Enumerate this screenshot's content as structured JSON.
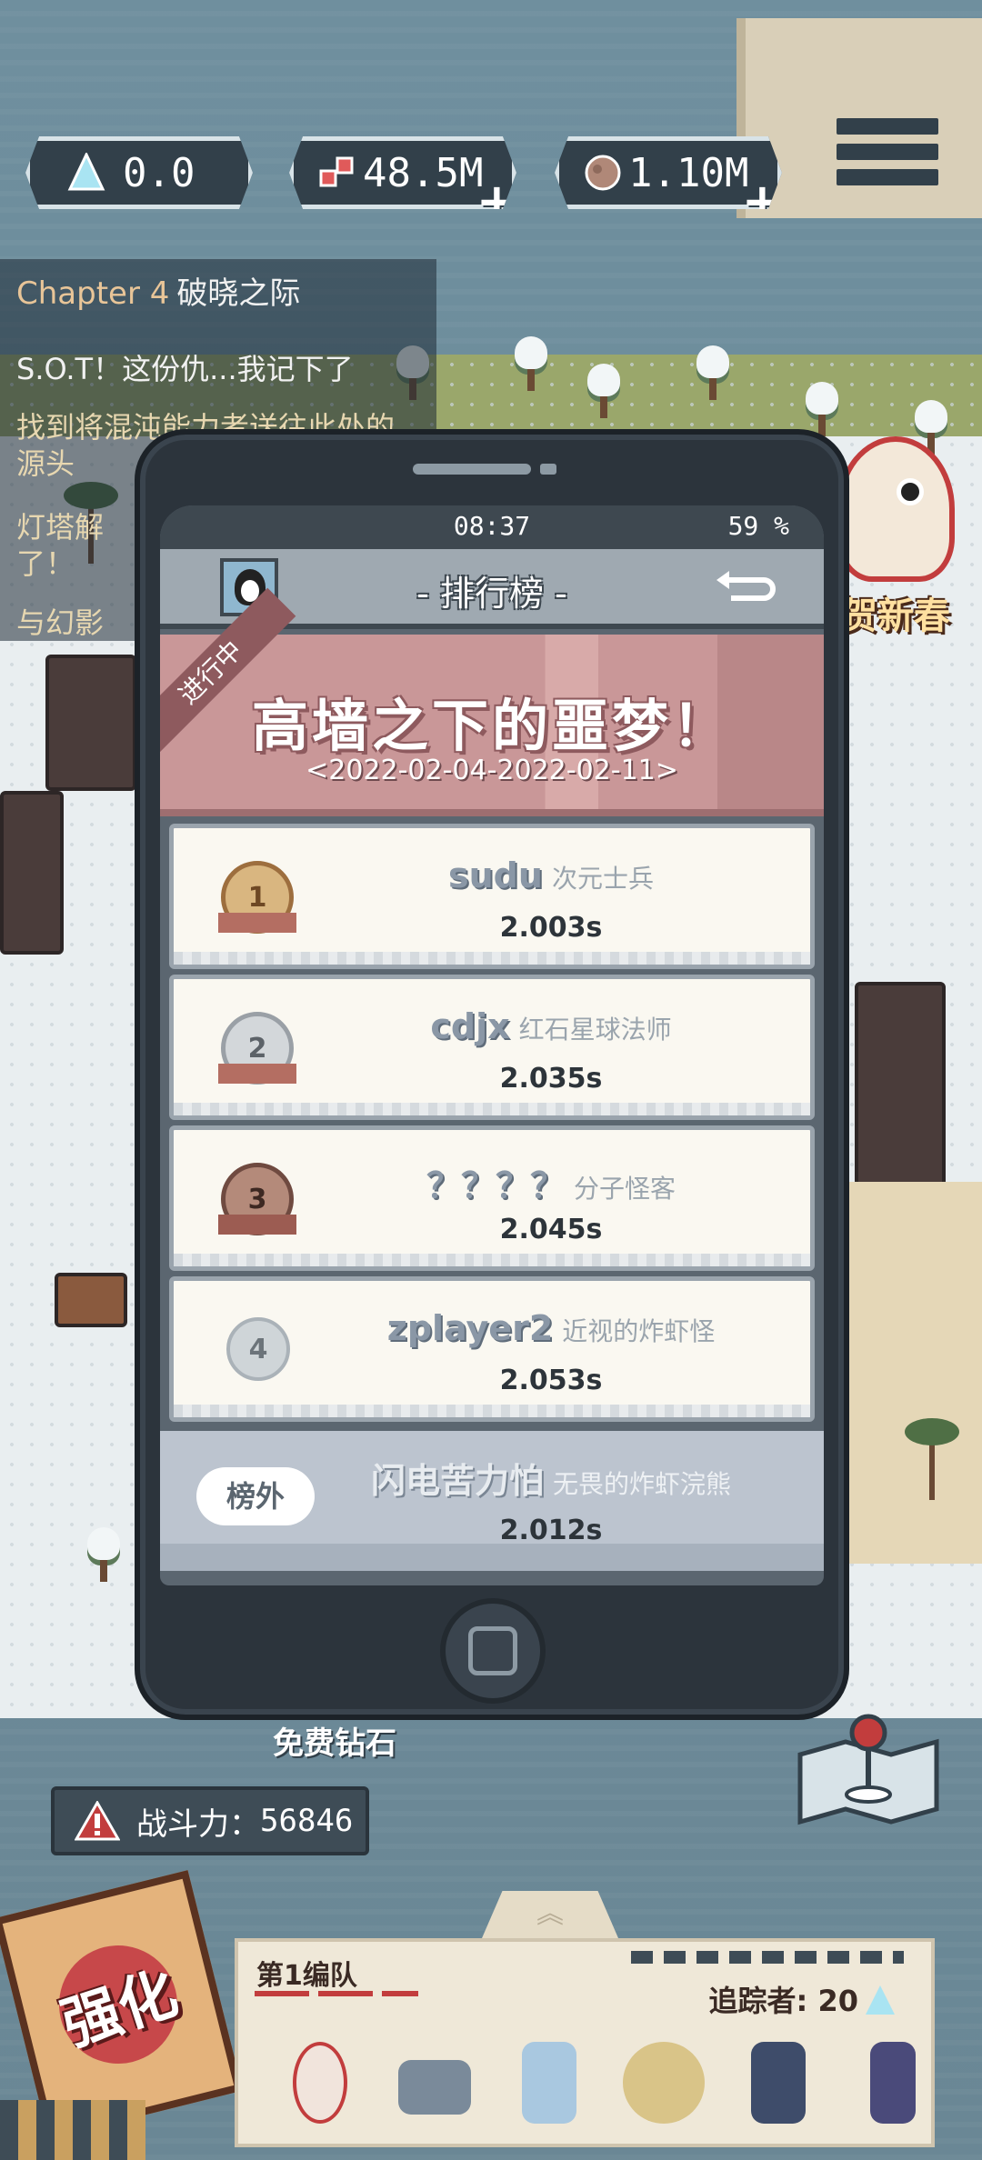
{
  "hud": {
    "crystal_value": "0.0",
    "gems_value": "48.5M",
    "ore_value": "1.10M",
    "crystal_icon": "blue-crystal-icon",
    "gems_icon": "red-gems-icon",
    "ore_icon": "ore-rock-icon",
    "menu_icon": "hamburger-menu-icon"
  },
  "quest": {
    "chapter": "Chapter 4",
    "chapter_title": "破晓之际",
    "lines": [
      "S.O.T！这份仇...我记下了",
      "找到将混沌能力者送往此处的",
      "源头",
      "灯塔解",
      "了！",
      "与幻影"
    ]
  },
  "phone": {
    "time": "08:37",
    "battery": "59 %",
    "header_title": "- 排行榜 -",
    "banner_ribbon": "进行中",
    "event_title": "高墙之下的噩梦！",
    "event_dates": "<2022-02-04-2022-02-11>",
    "ranks": [
      {
        "rank": "1",
        "player": "sudu",
        "title": "次元士兵",
        "time": "2.003s"
      },
      {
        "rank": "2",
        "player": "cdjx",
        "title": "红石星球法师",
        "time": "2.035s"
      },
      {
        "rank": "3",
        "player": "？？？？",
        "title": "分子怪客",
        "time": "2.045s"
      },
      {
        "rank": "4",
        "player": "zplayer2",
        "title": "近视的炸虾怪",
        "time": "2.053s"
      }
    ],
    "self": {
      "badge": "榜外",
      "player": "闪电苦力怕",
      "title": "无畏的炸虾浣熊",
      "time": "2.012s"
    }
  },
  "world": {
    "new_year_text": "贺新春"
  },
  "bottom": {
    "free_diamond": "免费钻石",
    "power_label": "战斗力：",
    "power_value": "56846",
    "upgrade_label": "强化",
    "team_name": "第1编队",
    "tracker_label": "追踪者: 20"
  },
  "colors": {
    "panel_dark": "#2c343c",
    "banner": "#c99798",
    "accent_blue": "#a9e4f2",
    "warn_red": "#c23d3d"
  }
}
